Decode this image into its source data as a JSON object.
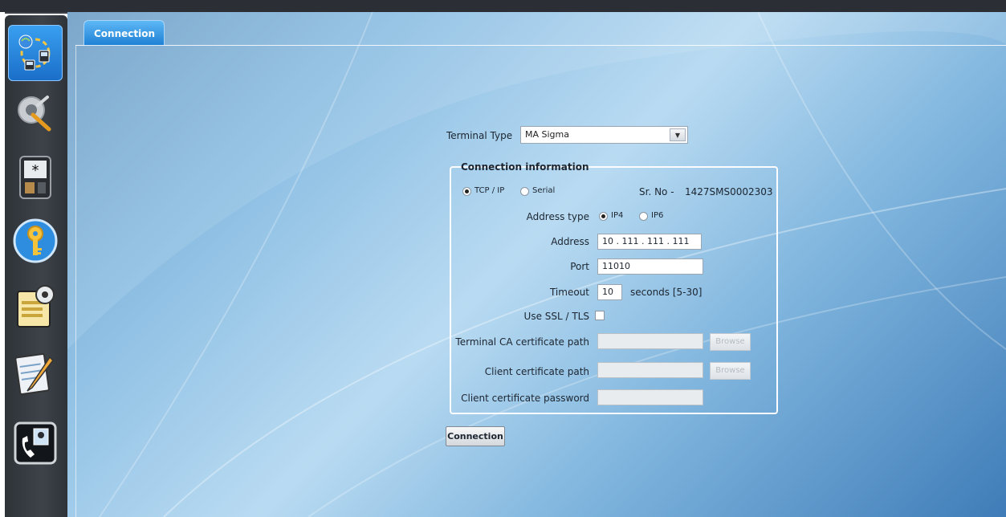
{
  "tab": {
    "label": "Connection"
  },
  "sidebar": {
    "items": [
      {
        "name": "connection",
        "icon": "network-connection-icon",
        "active": true
      },
      {
        "name": "tools",
        "icon": "tools-icon",
        "active": false
      },
      {
        "name": "terminal",
        "icon": "terminal-device-icon",
        "active": false
      },
      {
        "name": "security",
        "icon": "key-icon",
        "active": false
      },
      {
        "name": "settings",
        "icon": "settings-document-icon",
        "active": false
      },
      {
        "name": "notes",
        "icon": "notepad-pencil-icon",
        "active": false
      },
      {
        "name": "contact",
        "icon": "phone-contact-icon",
        "active": false
      }
    ]
  },
  "terminal_type": {
    "label": "Terminal Type",
    "value": "MA Sigma"
  },
  "connection_info": {
    "title": "Connection information",
    "mode_tcp": "TCP / IP",
    "mode_serial": "Serial",
    "selected_mode": "TCP / IP",
    "serial_no_label": "Sr. No  -",
    "serial_no": "1427SMS0002303",
    "address_type_label": "Address type",
    "ip4": "IP4",
    "ip6": "IP6",
    "selected_address_type": "IP4",
    "address_label": "Address",
    "address_value": "10  . 111 . 111 . 111",
    "port_label": "Port",
    "port_value": "11010",
    "timeout_label": "Timeout",
    "timeout_value": "10",
    "timeout_unit": "seconds [5-30]",
    "ssl_label": "Use SSL / TLS",
    "ssl_checked": false,
    "ca_path_label": "Terminal CA certificate path",
    "ca_path_value": "",
    "client_cert_label": "Client certificate path",
    "client_cert_value": "",
    "client_pwd_label": "Client certificate password",
    "client_pwd_value": "",
    "browse_label": "Browse"
  },
  "connect_button": "Connection",
  "colors": {
    "accent": "#1e7fd4",
    "sidebar": "#3a3f45",
    "background": "#8fc0e4"
  }
}
